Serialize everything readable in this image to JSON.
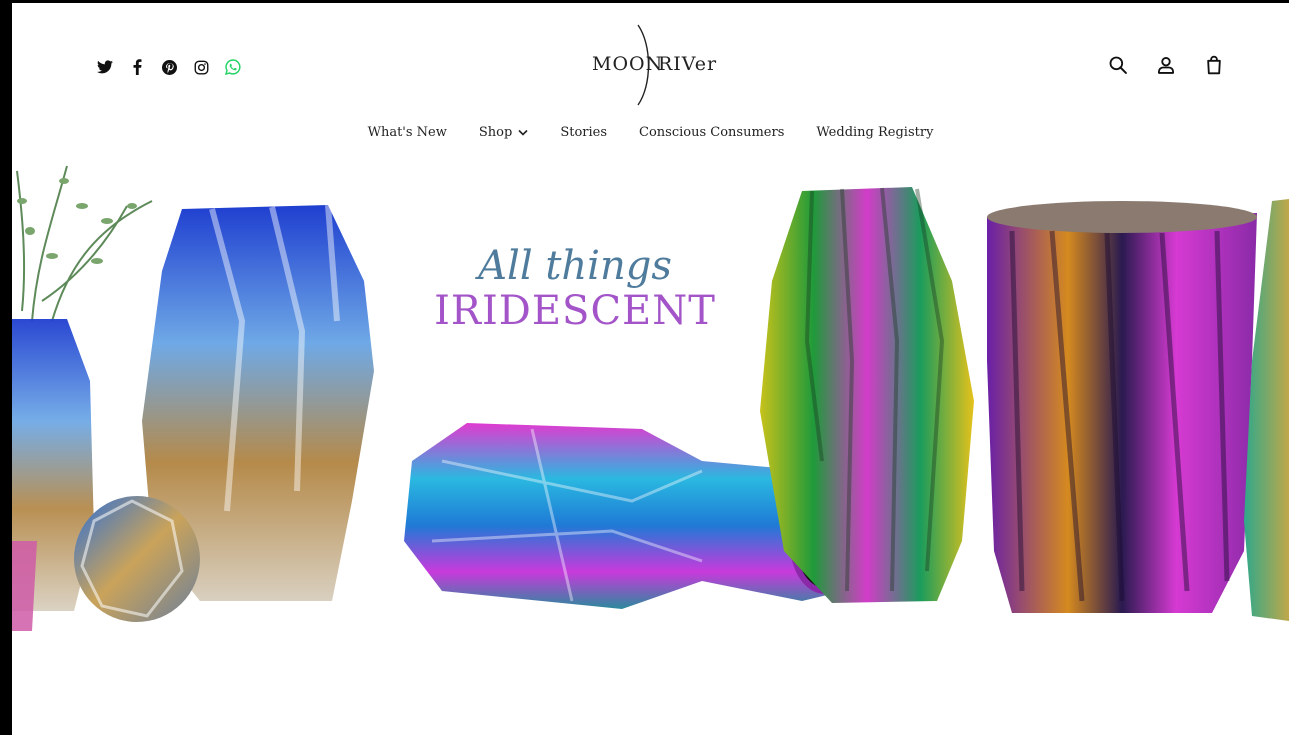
{
  "brand": {
    "word1": "MOON",
    "word2": "RIVer"
  },
  "social_icons": [
    "twitter-icon",
    "facebook-icon",
    "pinterest-icon",
    "instagram-icon",
    "whatsapp-icon"
  ],
  "header_icons": [
    "search-icon",
    "account-icon",
    "cart-icon"
  ],
  "nav": {
    "items": [
      {
        "label": "What's New"
      },
      {
        "label": "Shop"
      },
      {
        "label": "Stories"
      },
      {
        "label": "Conscious Consumers"
      },
      {
        "label": "Wedding Registry"
      }
    ]
  },
  "hero": {
    "line1": "All things",
    "line2": "IRIDESCENT"
  },
  "colors": {
    "whatsapp": "#25d366",
    "hero_line1": "#4f7c9c",
    "hero_line2": "#a354c9"
  }
}
